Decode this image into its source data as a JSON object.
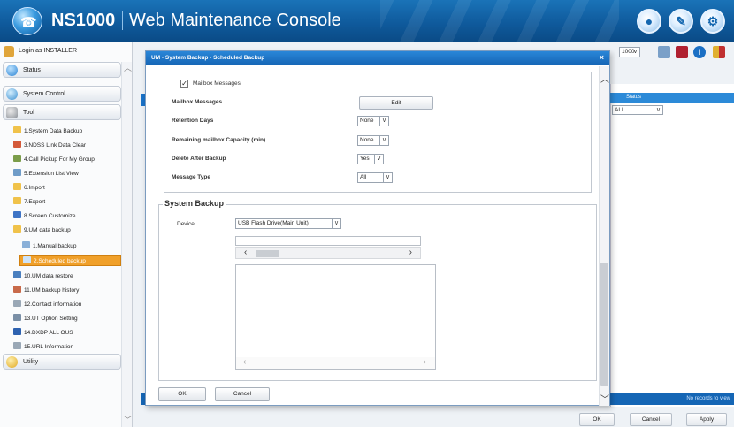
{
  "header": {
    "title_brand": "NS1000",
    "title_app": "Web Maintenance Console"
  },
  "sidebar": {
    "login": "Login as INSTALLER",
    "categories": {
      "status": "Status",
      "system_control": "System Control",
      "tool": "Tool",
      "utility": "Utility"
    },
    "items": [
      "1.System Data Backup",
      "3.NDSS Link Data Clear",
      "4.Call Pickup For My Group",
      "5.Extension List View",
      "6.Import",
      "7.Export",
      "8.Screen Customize",
      "9.UM data backup",
      "1.Manual backup",
      "2.Scheduled backup",
      "10.UM data restore",
      "11.UM backup history",
      "12.Contact information",
      "13.UT Option Setting",
      "14.DXDP ALL OUS",
      "15.URL Information"
    ]
  },
  "topbar": {
    "unit_select": "1000"
  },
  "background_table": {
    "status_header": "Status",
    "status_filter": "ALL",
    "footer_text": "No records to view"
  },
  "footer_buttons": {
    "ok": "OK",
    "cancel": "Cancel",
    "apply": "Apply"
  },
  "modal": {
    "title": "UM - System Backup - Scheduled Backup",
    "mailbox_messages_checkbox": "Mailbox Messages",
    "mailbox_messages_label": "Mailbox Messages",
    "edit_label": "Edit",
    "retention_days_label": "Retention Days",
    "retention_days_value": "None",
    "remaining_capacity_label": "Remaining mailbox Capacity (min)",
    "remaining_capacity_value": "None",
    "delete_after_backup_label": "Delete After Backup",
    "delete_after_backup_value": "Yes",
    "message_type_label": "Message Type",
    "message_type_value": "All",
    "system_backup_legend": "System Backup",
    "device_label": "Device",
    "device_value": "USB Flash Drive(Main Unit)",
    "ok_label": "OK",
    "cancel_label": "Cancel"
  }
}
